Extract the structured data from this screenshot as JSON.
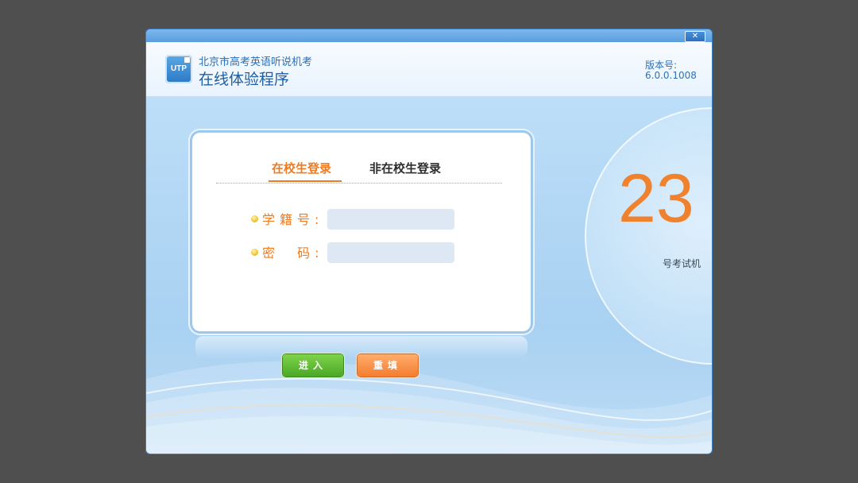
{
  "window": {
    "close_label": "✕"
  },
  "header": {
    "logo_text": "UTP",
    "subtitle": "北京市高考英语听说机考",
    "title": "在线体验程序",
    "version_label": "版本号:",
    "version_value": "6.0.0.1008"
  },
  "login": {
    "tabs": [
      {
        "label": "在校生登录",
        "active": true
      },
      {
        "label": "非在校生登录",
        "active": false
      }
    ],
    "fields": [
      {
        "label": "学籍号:",
        "value": "",
        "placeholder": ""
      },
      {
        "label": "密  码:",
        "value": "",
        "placeholder": ""
      }
    ],
    "buttons": {
      "enter_label": "进入",
      "reset_label": "重填"
    }
  },
  "machine": {
    "number": "23",
    "label": "号考试机"
  },
  "colors": {
    "accent_orange": "#ee7b22",
    "enter_green": "#4aa825",
    "brand_blue": "#2a6fb3"
  }
}
